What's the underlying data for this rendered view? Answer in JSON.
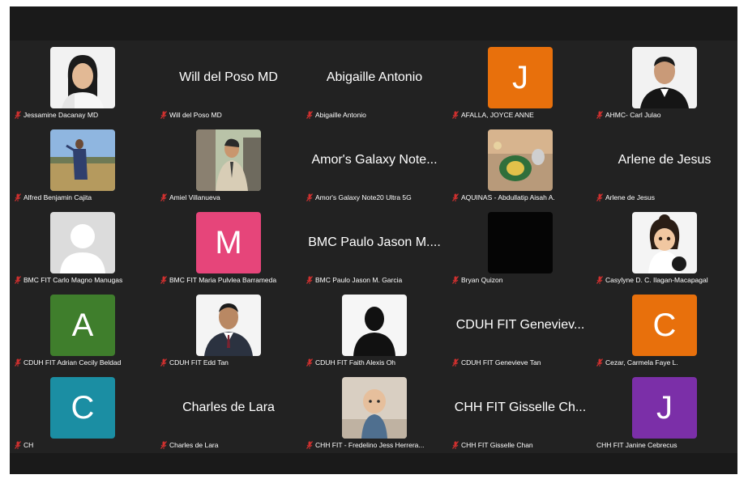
{
  "participants": [
    {
      "caption": "Jessamine Dacanay MD",
      "kind": "photo",
      "icon": "woman-portrait-photo",
      "bg": "#f2f2f2"
    },
    {
      "caption": "Will del Poso MD",
      "kind": "name",
      "display": "Will del Poso MD"
    },
    {
      "caption": "Abigaille Antonio",
      "kind": "name",
      "display": "Abigaille Antonio"
    },
    {
      "caption": "AFALLA, JOYCE ANNE",
      "kind": "letter",
      "letter": "J",
      "color": "#e8700c"
    },
    {
      "caption": "AHMC- Carl Julao",
      "kind": "photo",
      "icon": "man-portrait-photo",
      "bg": "#f2f2f2"
    },
    {
      "caption": "Alfred Benjamin Cajita",
      "kind": "photo",
      "icon": "outdoor-photo",
      "bg": "#7aa8d8"
    },
    {
      "caption": "Amiel Villanueva",
      "kind": "photo",
      "icon": "man-outdoor-photo",
      "bg": "#c8bfae"
    },
    {
      "caption": "Amor's Galaxy Note20 Ultra 5G",
      "kind": "name",
      "display": "Amor's Galaxy Note..."
    },
    {
      "caption": "AQUINAS - Abdullatip Aisah A.",
      "kind": "photo",
      "icon": "food-photo",
      "bg": "#b89a7a"
    },
    {
      "caption": "Arlene de Jesus",
      "kind": "name",
      "display": "Arlene de Jesus"
    },
    {
      "caption": "BMC FIT Carlo Magno Manugas",
      "kind": "photo",
      "icon": "default-avatar-icon",
      "bg": "#dcdcdc"
    },
    {
      "caption": "BMC FIT Maria Pulvlea Barrameda",
      "kind": "letter",
      "letter": "M",
      "color": "#e6457a"
    },
    {
      "caption": "BMC Paulo Jason M. Garcia",
      "kind": "name",
      "display": "BMC Paulo Jason M...."
    },
    {
      "caption": "Bryan Quizon",
      "kind": "photo",
      "icon": "black-video-icon",
      "bg": "#050505"
    },
    {
      "caption": "Casylyne D. C. Ilagan-Macapagal",
      "kind": "photo",
      "icon": "cartoon-avatar-photo",
      "bg": "#f4f4f4"
    },
    {
      "caption": "CDUH FIT Adrian Cecily Beldad",
      "kind": "letter",
      "letter": "A",
      "color": "#3f7e2c"
    },
    {
      "caption": "CDUH FIT Edd Tan",
      "kind": "photo",
      "icon": "man-suit-photo",
      "bg": "#f4f4f4"
    },
    {
      "caption": "CDUH FIT Faith Alexis Oh",
      "kind": "photo",
      "icon": "silhouette-photo",
      "bg": "#f6f6f6"
    },
    {
      "caption": "CDUH FIT Genevieve Tan",
      "kind": "name",
      "display": "CDUH FIT Geneviev..."
    },
    {
      "caption": "Cezar, Carmela Faye L.",
      "kind": "letter",
      "letter": "C",
      "color": "#e8700c"
    },
    {
      "caption": "CH",
      "kind": "letter",
      "letter": "C",
      "color": "#1b8ea3"
    },
    {
      "caption": "Charles de Lara",
      "kind": "name",
      "display": "Charles de Lara"
    },
    {
      "caption": "CHH FIT - Fredelino Jess Herrera...",
      "kind": "photo",
      "icon": "baby-photo",
      "bg": "#d9cfc2"
    },
    {
      "caption": "CHH FIT Gisselle Chan",
      "kind": "name",
      "display": "CHH FIT Gisselle Ch..."
    },
    {
      "caption": "CHH FIT Janine Cebrecus",
      "kind": "letter",
      "letter": "J",
      "color": "#7b2fa8",
      "nomic": true
    }
  ],
  "colors": {
    "background": "#222222",
    "frame": "#1a1a1a",
    "muted": "#d0302f"
  }
}
